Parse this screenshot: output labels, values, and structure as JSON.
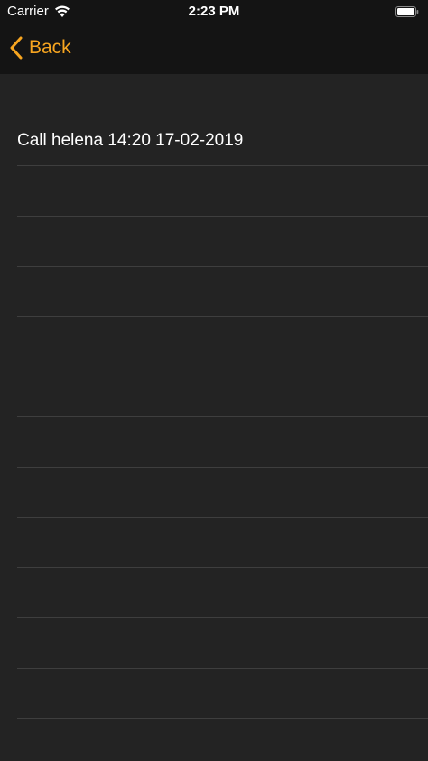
{
  "status_bar": {
    "carrier": "Carrier",
    "time": "2:23 PM",
    "wifi_icon": "wifi-icon",
    "battery_icon": "battery-icon"
  },
  "nav_bar": {
    "back_label": "Back",
    "back_icon": "chevron-left-icon"
  },
  "colors": {
    "accent": "#f7a520",
    "background": "#232323",
    "bar_background": "#141414",
    "separator": "#3e3e3e",
    "text": "#ffffff"
  },
  "list": {
    "rows": [
      {
        "text": "Call helena 14:20 17-02-2019"
      },
      {
        "text": ""
      },
      {
        "text": ""
      },
      {
        "text": ""
      },
      {
        "text": ""
      },
      {
        "text": ""
      },
      {
        "text": ""
      },
      {
        "text": ""
      },
      {
        "text": ""
      },
      {
        "text": ""
      },
      {
        "text": ""
      },
      {
        "text": ""
      }
    ]
  }
}
